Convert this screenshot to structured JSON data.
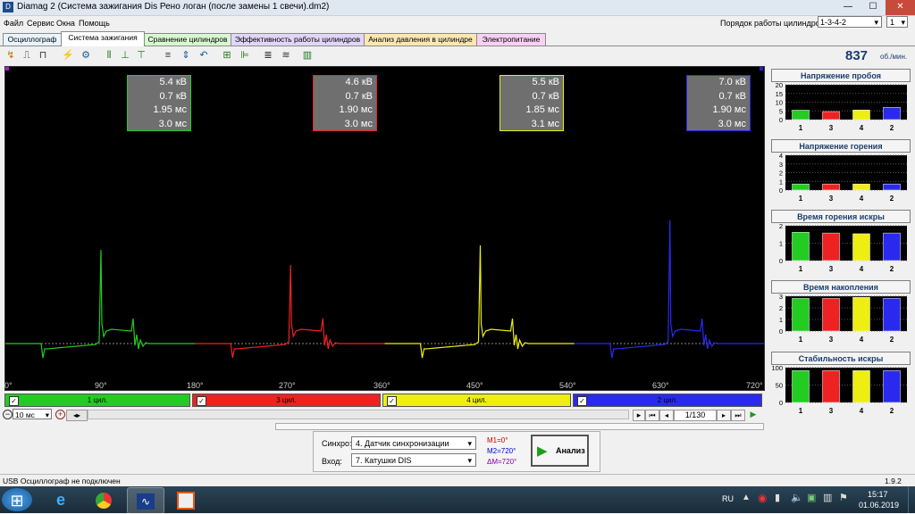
{
  "window": {
    "title": "Diamag 2 (Система зажигания Dis Рено логан (после замены 1 свечи).dm2)",
    "minimize": "—",
    "maximize": "☐",
    "close": "✕"
  },
  "menu": [
    "Файл",
    "Сервис",
    "Окна",
    "Помощь"
  ],
  "cyl_order": {
    "label": "Порядок работы цилиндров",
    "value": "1-3-4-2",
    "count": "1"
  },
  "tabs": [
    {
      "label": "Осциллограф",
      "color": "#e8f4ff"
    },
    {
      "label": "Система зажигания",
      "color": "#ffffff"
    },
    {
      "label": "Сравнение цилиндров",
      "color": "#d8f8d0"
    },
    {
      "label": "Эффективность работы цилиндров",
      "color": "#e0d6f8"
    },
    {
      "label": "Анализ давления в цилиндре",
      "color": "#fbe8b0"
    },
    {
      "label": "Электропитание",
      "color": "#f8d0f4"
    }
  ],
  "rpm": {
    "value": "837",
    "unit": "об./мин."
  },
  "cylinders": [
    {
      "color": "#22cc22",
      "kv_peak": "5.4 кВ",
      "kv_burn": "0.7 кВ",
      "burn_time": "1.95 мс",
      "dwell": "3.0 мс",
      "label": "1 цил."
    },
    {
      "color": "#ee2222",
      "kv_peak": "4.6 кВ",
      "kv_burn": "0.7 кВ",
      "burn_time": "1.90 мс",
      "dwell": "3.0 мс",
      "label": "3 цил."
    },
    {
      "color": "#eeee11",
      "kv_peak": "5.5 кВ",
      "kv_burn": "0.7 кВ",
      "burn_time": "1.85 мс",
      "dwell": "3.1 мс",
      "label": "4 цил."
    },
    {
      "color": "#2a2aee",
      "kv_peak": "7.0 кВ",
      "kv_burn": "0.7 кВ",
      "burn_time": "1.90 мс",
      "dwell": "3.0 мс",
      "label": "2 цил."
    }
  ],
  "degree_ticks": [
    "0°",
    "90°",
    "180°",
    "270°",
    "360°",
    "450°",
    "540°",
    "630°",
    "720°"
  ],
  "nav": {
    "timebase": "10 мс",
    "page": "1/130"
  },
  "synchro": {
    "label": "Синхро:",
    "value": "4.  Датчик синхронизации"
  },
  "input": {
    "label": "Вход:",
    "value": "7.  Катушки DIS"
  },
  "markers": {
    "m1": "M1=0°",
    "m2": "M2=720°",
    "dm": "ΔM=720°"
  },
  "analyze_label": "Анализ",
  "panels": {
    "p1_title": "Напряжение пробоя",
    "p2_title": "Напряжение горения",
    "p3_title": "Время горения искры",
    "p4_title": "Время накопления",
    "p5_title": "Стабильность искры",
    "bar_labels": [
      "1",
      "3",
      "4",
      "2"
    ]
  },
  "chart_data": [
    {
      "type": "bar",
      "title": "Напряжение пробоя",
      "categories": [
        "1",
        "3",
        "4",
        "2"
      ],
      "values": [
        5.4,
        4.6,
        5.5,
        7.0
      ],
      "yticks": [
        "20",
        "15",
        "10",
        "5",
        "0"
      ],
      "ylim": [
        0,
        20
      ]
    },
    {
      "type": "bar",
      "title": "Напряжение горения",
      "categories": [
        "1",
        "3",
        "4",
        "2"
      ],
      "values": [
        0.7,
        0.7,
        0.7,
        0.7
      ],
      "yticks": [
        "4",
        "3",
        "2",
        "1",
        "0"
      ],
      "ylim": [
        0,
        4
      ]
    },
    {
      "type": "bar",
      "title": "Время горения искры",
      "categories": [
        "1",
        "3",
        "4",
        "2"
      ],
      "values": [
        1.95,
        1.9,
        1.85,
        1.9
      ],
      "yticks": [
        "2",
        "1",
        "0"
      ],
      "ylim": [
        0,
        2.4
      ]
    },
    {
      "type": "bar",
      "title": "Время накопления",
      "categories": [
        "1",
        "3",
        "4",
        "2"
      ],
      "values": [
        3.0,
        3.0,
        3.1,
        3.0
      ],
      "yticks": [
        "3",
        "2",
        "1",
        "0"
      ],
      "ylim": [
        0,
        3.2
      ]
    },
    {
      "type": "bar",
      "title": "Стабильность искры",
      "categories": [
        "1",
        "3",
        "4",
        "2"
      ],
      "values": [
        96,
        96,
        96,
        96
      ],
      "yticks": [
        "100",
        "50",
        "0"
      ],
      "ylim": [
        0,
        105
      ]
    }
  ],
  "status": {
    "left": "USB Осциллограф не подключен",
    "version": "1.9.2"
  },
  "taskbar": {
    "lang": "RU",
    "time": "15:17",
    "date": "01.06.2019"
  }
}
